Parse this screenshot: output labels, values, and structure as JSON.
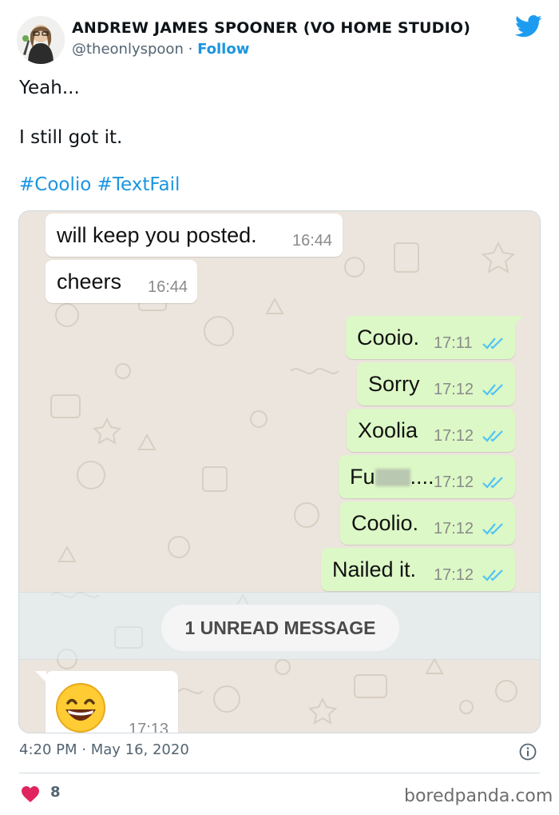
{
  "tweet": {
    "author_name": "ANDREW JAMES SPOONER (VO HOME STUDIO)",
    "handle": "@theonlyspoon",
    "separator": "·",
    "follow_label": "Follow",
    "lines": [
      "Yeah...",
      "I still got it."
    ],
    "hashtags": [
      "#Coolio",
      "#TextFail"
    ],
    "timestamp": "4:20 PM · May 16, 2020",
    "like_count": "8",
    "brand_color": "#1b95e0",
    "like_color": "#e0245e"
  },
  "chat": {
    "incoming": [
      {
        "text": "will keep you posted.",
        "time": "16:44"
      },
      {
        "text": "cheers",
        "time": "16:44"
      }
    ],
    "outgoing": [
      {
        "text": "Cooio.",
        "time": "17:11"
      },
      {
        "text": "Sorry",
        "time": "17:12"
      },
      {
        "text": "Xoolia",
        "time": "17:12"
      },
      {
        "text_start": "Fu",
        "text_end": "....",
        "time": "17:12"
      },
      {
        "text": "Coolio.",
        "time": "17:12"
      },
      {
        "text": "Nailed it.",
        "time": "17:12"
      }
    ],
    "unread_label": "1 UNREAD MESSAGE",
    "last_message": {
      "emoji": "grinning-face-with-smiling-eyes",
      "time": "17:13"
    },
    "outgoing_bubble_color": "#dcf8c6",
    "read_tick_color": "#4fc3f7",
    "wallpaper_color": "#ece5dd"
  },
  "watermark": "boredpanda.com",
  "icons": {
    "brand": "twitter-bird-icon",
    "info": "info-icon",
    "like": "heart-icon",
    "read_status": "double-check-icon"
  }
}
